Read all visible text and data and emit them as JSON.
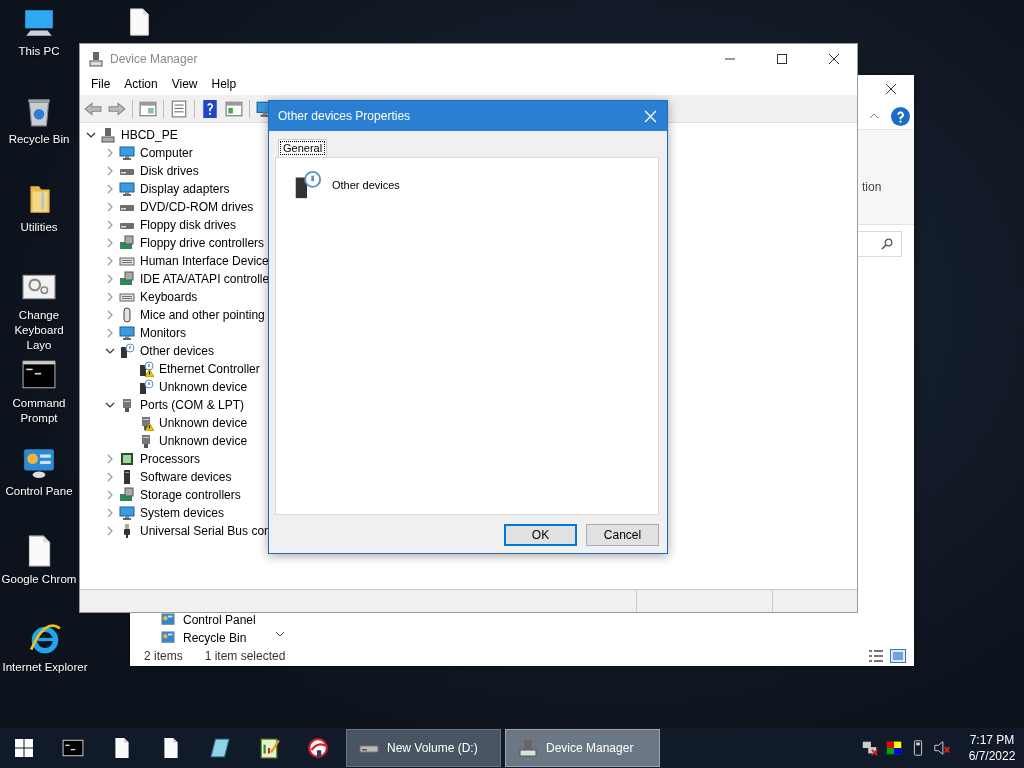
{
  "desktop_icons": [
    {
      "label": "This PC",
      "kind": "computer"
    },
    {
      "label": "Recycle Bin",
      "kind": "bin"
    },
    {
      "label": "Utilities",
      "kind": "folder"
    },
    {
      "label": "Change Keyboard Layo",
      "kind": "settings"
    },
    {
      "label": "Command Prompt",
      "kind": "console"
    },
    {
      "label": "Control Pane",
      "kind": "control"
    },
    {
      "label": "Google Chrom",
      "kind": "file"
    },
    {
      "label": "Internet Explorer",
      "kind": "browser"
    }
  ],
  "explorer_window": {
    "ribbon_label": "tion",
    "nav_items": [
      {
        "label": "Control Panel"
      },
      {
        "label": "Recycle Bin"
      }
    ],
    "status": [
      "2 items",
      "1 item selected"
    ]
  },
  "device_manager": {
    "title": "Device Manager",
    "menu": [
      "File",
      "Action",
      "View",
      "Help"
    ],
    "toolbar": [
      {
        "kind": "back"
      },
      {
        "kind": "forward"
      },
      {
        "kind": "grid"
      },
      {
        "kind": "list"
      },
      {
        "kind": "help"
      },
      {
        "kind": "panel"
      },
      {
        "kind": "monitor"
      }
    ],
    "tree": [
      {
        "label": "HBCD_PE",
        "kind": "computer",
        "expanded": true,
        "children": [
          {
            "label": "Computer",
            "kind": "monitor",
            "expanded": false
          },
          {
            "label": "Disk drives",
            "kind": "drive",
            "expanded": false
          },
          {
            "label": "Display adapters",
            "kind": "monitor",
            "expanded": false
          },
          {
            "label": "DVD/CD-ROM drives",
            "kind": "drive",
            "expanded": false
          },
          {
            "label": "Floppy disk drives",
            "kind": "drive",
            "expanded": false
          },
          {
            "label": "Floppy drive controllers",
            "kind": "board",
            "expanded": false
          },
          {
            "label": "Human Interface Device",
            "kind": "keyboard",
            "expanded": false
          },
          {
            "label": "IDE ATA/ATAPI controlle",
            "kind": "board",
            "expanded": false
          },
          {
            "label": "Keyboards",
            "kind": "keyboard",
            "expanded": false
          },
          {
            "label": "Mice and other pointing",
            "kind": "mouse",
            "expanded": false
          },
          {
            "label": "Monitors",
            "kind": "monitor",
            "expanded": false
          },
          {
            "label": "Other devices",
            "kind": "unknown",
            "expanded": true,
            "children": [
              {
                "label": "Ethernet Controller",
                "kind": "unknown",
                "warning": true
              },
              {
                "label": "Unknown device",
                "kind": "unknown",
                "warning": false
              }
            ]
          },
          {
            "label": "Ports (COM & LPT)",
            "kind": "port",
            "expanded": true,
            "children": [
              {
                "label": "Unknown device",
                "kind": "port",
                "warning": true
              },
              {
                "label": "Unknown device",
                "kind": "port",
                "warning": false
              }
            ]
          },
          {
            "label": "Processors",
            "kind": "chip",
            "expanded": false
          },
          {
            "label": "Software devices",
            "kind": "tower",
            "expanded": false
          },
          {
            "label": "Storage controllers",
            "kind": "board",
            "expanded": false
          },
          {
            "label": "System devices",
            "kind": "monitor",
            "expanded": false
          },
          {
            "label": "Universal Serial Bus con",
            "kind": "usb",
            "expanded": false
          }
        ]
      }
    ]
  },
  "dialog": {
    "title": "Other devices Properties",
    "tabs": [
      {
        "label": "General",
        "selected": true
      }
    ],
    "device_name": "Other devices",
    "buttons": [
      {
        "label": "OK",
        "default": true
      },
      {
        "label": "Cancel",
        "default": false
      }
    ]
  },
  "taskbar": {
    "pinned": [
      {
        "kind": "console"
      },
      {
        "kind": "file"
      },
      {
        "kind": "file"
      },
      {
        "kind": "crystal"
      },
      {
        "kind": "notepad"
      },
      {
        "kind": "swirl"
      }
    ],
    "windows": [
      {
        "label": "New Volume (D:)",
        "kind": "drive",
        "selected": false
      },
      {
        "label": "Device Manager",
        "kind": "devmgr",
        "selected": true
      }
    ],
    "tray": [
      {
        "kind": "network"
      },
      {
        "kind": "color"
      },
      {
        "kind": "usb"
      },
      {
        "kind": "speaker"
      }
    ],
    "time": "7:17 PM",
    "date": "6/7/2022"
  }
}
